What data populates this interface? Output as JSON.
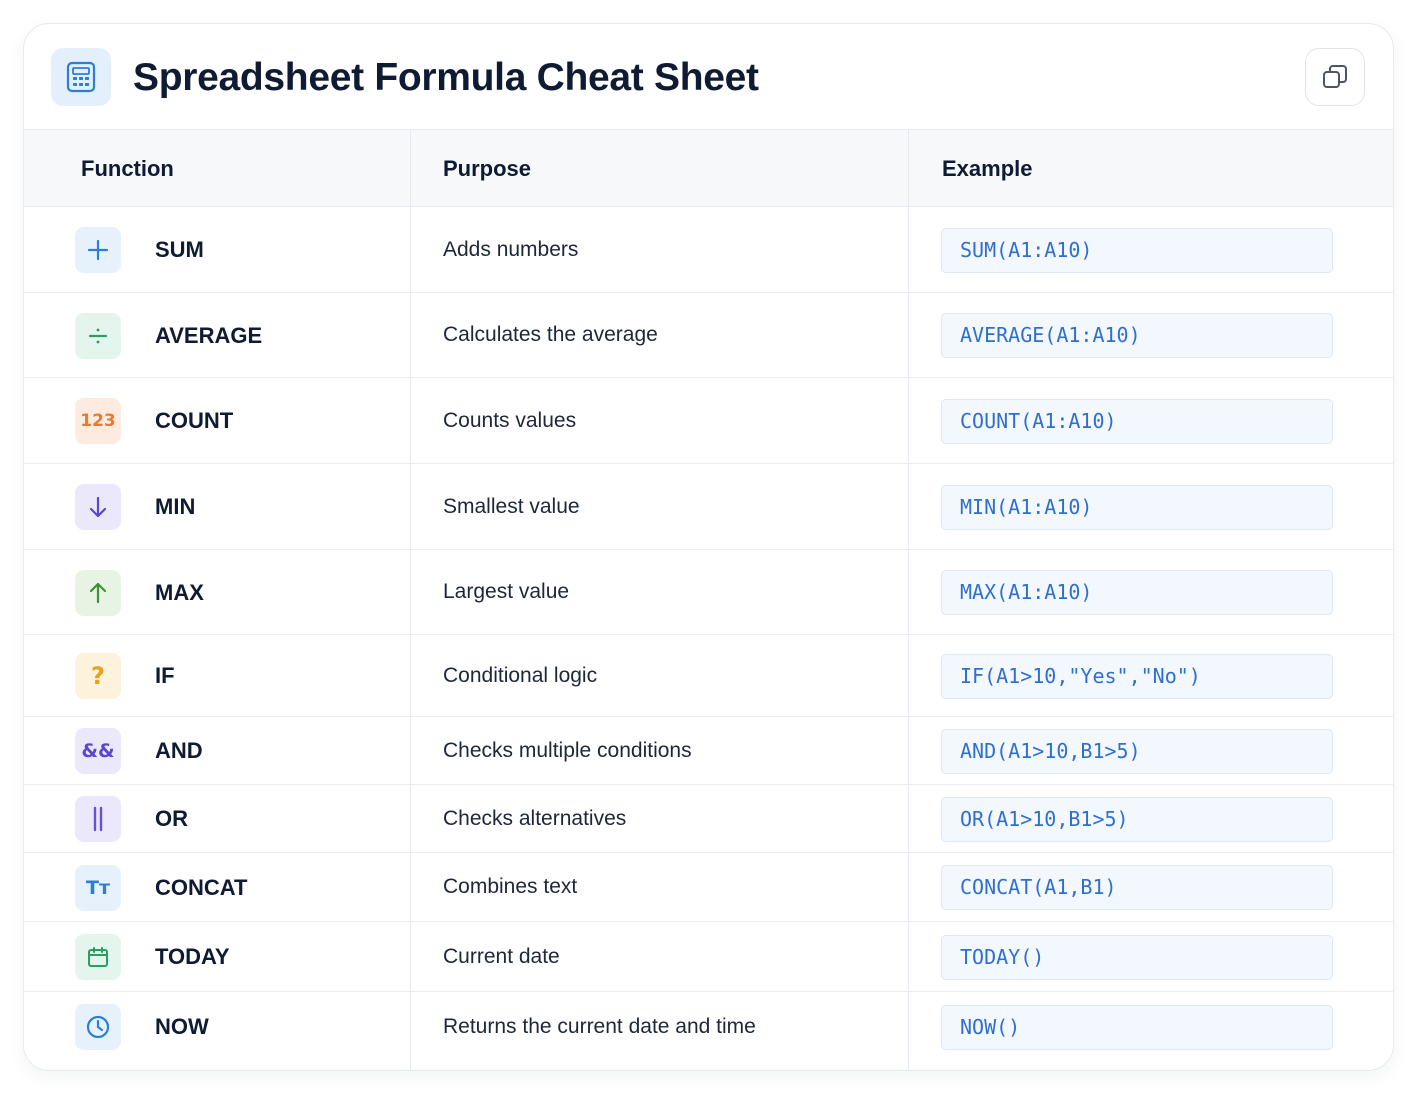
{
  "title": "Spreadsheet Formula Cheat Sheet",
  "header_icon": "calculator-icon",
  "copy_icon": "copy-icon",
  "columns": {
    "function": "Function",
    "purpose": "Purpose",
    "example": "Example"
  },
  "rows": [
    {
      "name": "SUM",
      "purpose": "Adds numbers",
      "example": "SUM(A1:A10)",
      "icon": "plus-icon",
      "icon_text": "",
      "icon_bg": "#e6f1fc",
      "icon_color": "#2b7fd6"
    },
    {
      "name": "AVERAGE",
      "purpose": "Calculates the average",
      "example": "AVERAGE(A1:A10)",
      "icon": "divide-icon",
      "icon_text": "",
      "icon_bg": "#e3f5ec",
      "icon_color": "#2a9d63"
    },
    {
      "name": "COUNT",
      "purpose": "Counts values",
      "example": "COUNT(A1:A10)",
      "icon": "number-icon",
      "icon_text": "123",
      "icon_bg": "#fdebdf",
      "icon_color": "#ea7a2f"
    },
    {
      "name": "MIN",
      "purpose": "Smallest value",
      "example": "MIN(A1:A10)",
      "icon": "arrow-down-icon",
      "icon_text": "",
      "icon_bg": "#ece8fb",
      "icon_color": "#5b47c9"
    },
    {
      "name": "MAX",
      "purpose": "Largest value",
      "example": "MAX(A1:A10)",
      "icon": "arrow-up-icon",
      "icon_text": "",
      "icon_bg": "#e8f4e3",
      "icon_color": "#3f8f34"
    },
    {
      "name": "IF",
      "purpose": "Conditional logic",
      "example": "IF(A1>10,\"Yes\",\"No\")",
      "icon": "question-icon",
      "icon_text": "?",
      "icon_bg": "#fdf3dc",
      "icon_color": "#e9a21b"
    },
    {
      "name": "AND",
      "purpose": "Checks multiple conditions",
      "example": "AND(A1>10,B1>5)",
      "icon": "ampersand-icon",
      "icon_text": "&&",
      "icon_bg": "#ece8fb",
      "icon_color": "#5b47c9"
    },
    {
      "name": "OR",
      "purpose": "Checks alternatives",
      "example": "OR(A1>10,B1>5)",
      "icon": "pipe-icon",
      "icon_text": "",
      "icon_bg": "#ece8fb",
      "icon_color": "#6a4fd6"
    },
    {
      "name": "CONCAT",
      "purpose": "Combines text",
      "example": "CONCAT(A1,B1)",
      "icon": "text-icon",
      "icon_text": "Tт",
      "icon_bg": "#e6f1fc",
      "icon_color": "#2b7fd6"
    },
    {
      "name": "TODAY",
      "purpose": "Current date",
      "example": "TODAY()",
      "icon": "calendar-icon",
      "icon_text": "",
      "icon_bg": "#e3f5ec",
      "icon_color": "#2a9d63"
    },
    {
      "name": "NOW",
      "purpose": "Returns the current date and time",
      "example": "NOW()",
      "icon": "clock-icon",
      "icon_text": "",
      "icon_bg": "#e6f1fc",
      "icon_color": "#2b7fd6"
    }
  ]
}
